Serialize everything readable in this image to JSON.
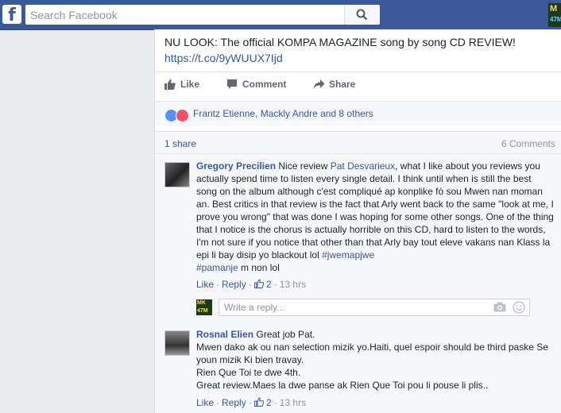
{
  "topbar": {
    "logo": "f",
    "search_placeholder": "Search Facebook",
    "profile_thumb_text": "M",
    "profile_thumb_sub": "47M"
  },
  "post": {
    "text": "NU LOOK: The official KOMPA MAGAZINE song by song CD REVIEW!",
    "link": "https://t.co/9yWUUX7Ijd"
  },
  "actions": {
    "like": "Like",
    "comment": "Comment",
    "share": "Share"
  },
  "reactions": {
    "names": "Frantz Etienne, Mackly Andre and 8 others"
  },
  "meta": {
    "shares": "1 share",
    "comments": "6 Comments"
  },
  "comments": [
    {
      "author": "Gregory Precilien",
      "text_before_tag": " Nice review ",
      "tag": "Pat Desvarieux",
      "text_after_tag": ", what I like about you reviews you actually spend time to listen every single detail. I think until when is still the best song on the album although c'est compliqué ap konplike fò sou Mwen nan moman an. Best critics in that review is the fact that Arly went back to the same \"look at me, I prove you wrong\" that was done I was hoping for some other songs. One of the thing that I notice is the chorus is actually horrible on this CD, hard to listen to the words, I'm not sure if you notice that other than that Arly bay tout eleve vakans nan Klass la epi li bay disip yo blackout lol ",
      "hashtag1": "#jwemapjwe",
      "hashtag2": "#pamanje",
      "text_end": " m non lol",
      "like": "Like",
      "reply": "Reply",
      "likes": "2",
      "time": "13 hrs"
    },
    {
      "author": "Rosnal Elien",
      "line1": " Great job Pat.",
      "line2": "Mwen dako ak ou nan selection mizik yo.Haiti, quel espoir should be third paske Se youn mizik Ki bien travay.",
      "line3": "Rien Que Toi te dwe 4th.",
      "line4": "Great review.Maes la dwe panse ak Rien Que Toi pou li pouse li plis..",
      "like": "Like",
      "reply": "Reply",
      "likes": "2",
      "time": "13 hrs"
    }
  ],
  "reply_box": {
    "avatar_text": "MK 47M",
    "placeholder": "Write a reply..."
  },
  "colors": {
    "brand": "#3b5998",
    "link": "#365899",
    "muted": "#90949c",
    "like_reaction": "#5890ff",
    "love_reaction": "#f25268"
  },
  "icons": {
    "search": "magnifier-icon",
    "like": "thumbs-up-icon",
    "comment": "speech-bubble-icon",
    "share": "share-arrow-icon",
    "camera": "camera-icon",
    "smiley": "smiley-icon"
  }
}
